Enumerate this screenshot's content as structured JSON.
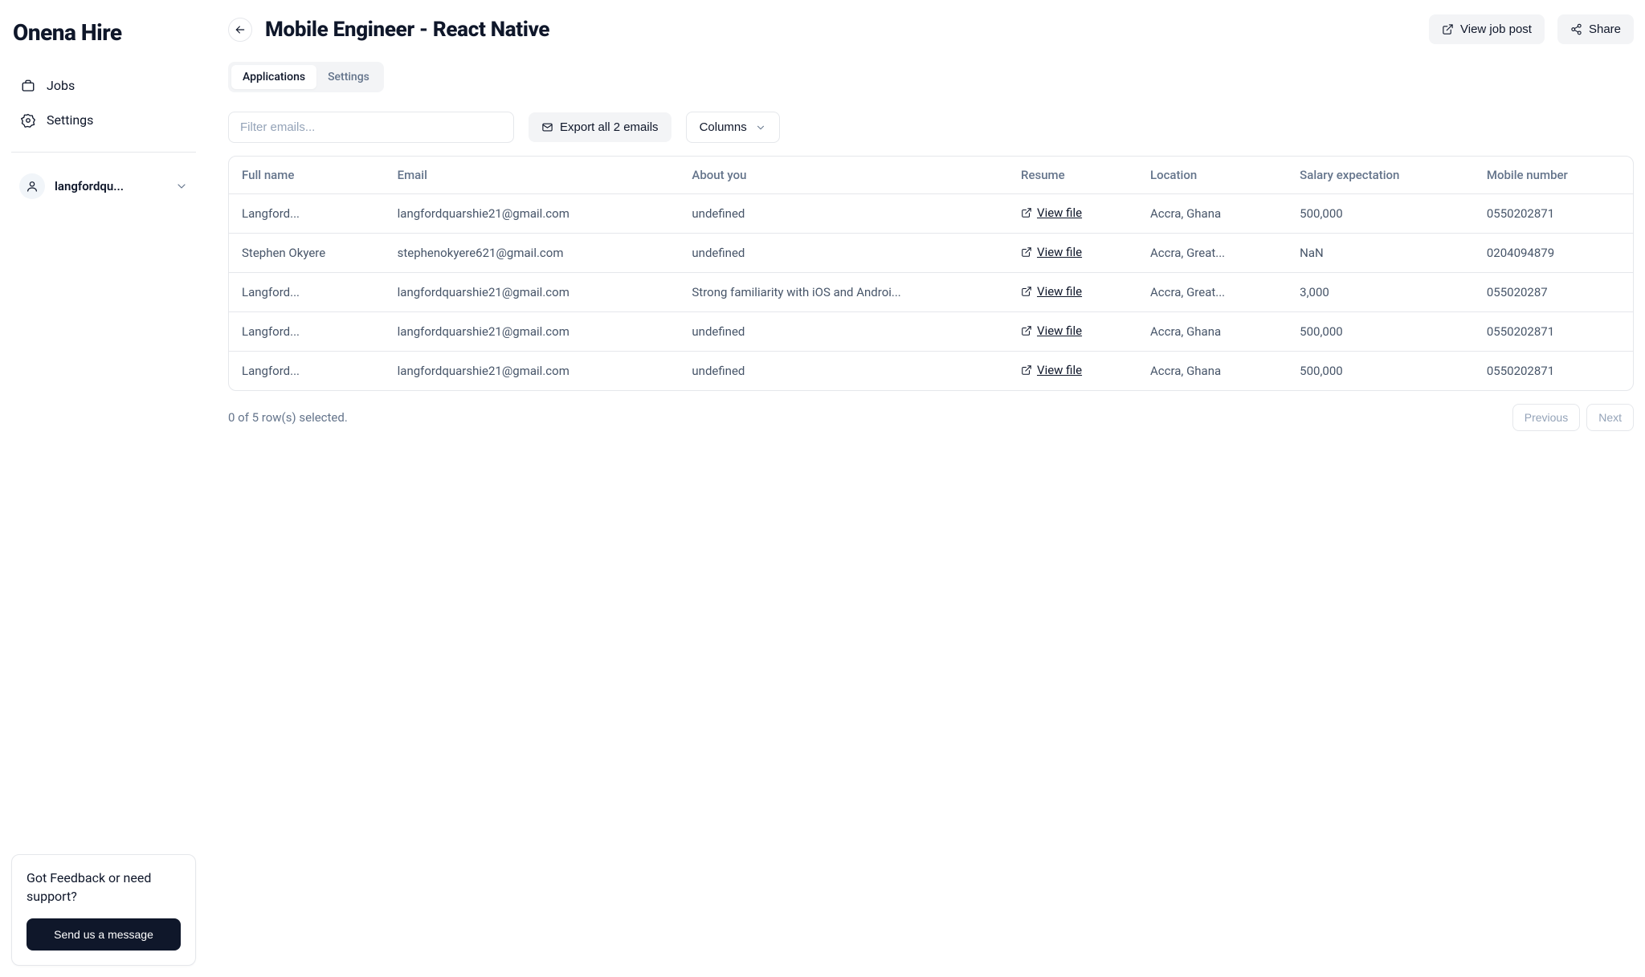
{
  "brand": "Onena Hire",
  "nav": {
    "jobs": "Jobs",
    "settings": "Settings"
  },
  "user": {
    "display": "langfordqu..."
  },
  "feedback": {
    "title": "Got Feedback or need support?",
    "cta": "Send us a message"
  },
  "page": {
    "title": "Mobile Engineer - React Native",
    "view_post": "View job post",
    "share": "Share"
  },
  "tabs": {
    "applications": "Applications",
    "settings": "Settings"
  },
  "toolbar": {
    "filter_placeholder": "Filter emails...",
    "export_label": "Export all 2 emails",
    "columns_label": "Columns"
  },
  "table": {
    "headers": {
      "full_name": "Full name",
      "email": "Email",
      "about": "About you",
      "resume": "Resume",
      "location": "Location",
      "salary": "Salary expectation",
      "mobile": "Mobile number"
    },
    "view_file_label": "View file",
    "rows": [
      {
        "name": "Langford...",
        "email": "langfordquarshie21@gmail.com",
        "about": "undefined",
        "location": "Accra, Ghana",
        "salary": "500,000",
        "mobile": "0550202871"
      },
      {
        "name": "Stephen Okyere",
        "email": "stephenokyere621@gmail.com",
        "about": "undefined",
        "location": "Accra, Great...",
        "salary": "NaN",
        "mobile": "0204094879"
      },
      {
        "name": "Langford...",
        "email": "langfordquarshie21@gmail.com",
        "about": "Strong familiarity with iOS and Androi...",
        "location": "Accra, Great...",
        "salary": "3,000",
        "mobile": "055020287"
      },
      {
        "name": "Langford...",
        "email": "langfordquarshie21@gmail.com",
        "about": "undefined",
        "location": "Accra, Ghana",
        "salary": "500,000",
        "mobile": "0550202871"
      },
      {
        "name": "Langford...",
        "email": "langfordquarshie21@gmail.com",
        "about": "undefined",
        "location": "Accra, Ghana",
        "salary": "500,000",
        "mobile": "0550202871"
      }
    ]
  },
  "footer": {
    "selection": "0 of 5 row(s) selected.",
    "previous": "Previous",
    "next": "Next"
  }
}
